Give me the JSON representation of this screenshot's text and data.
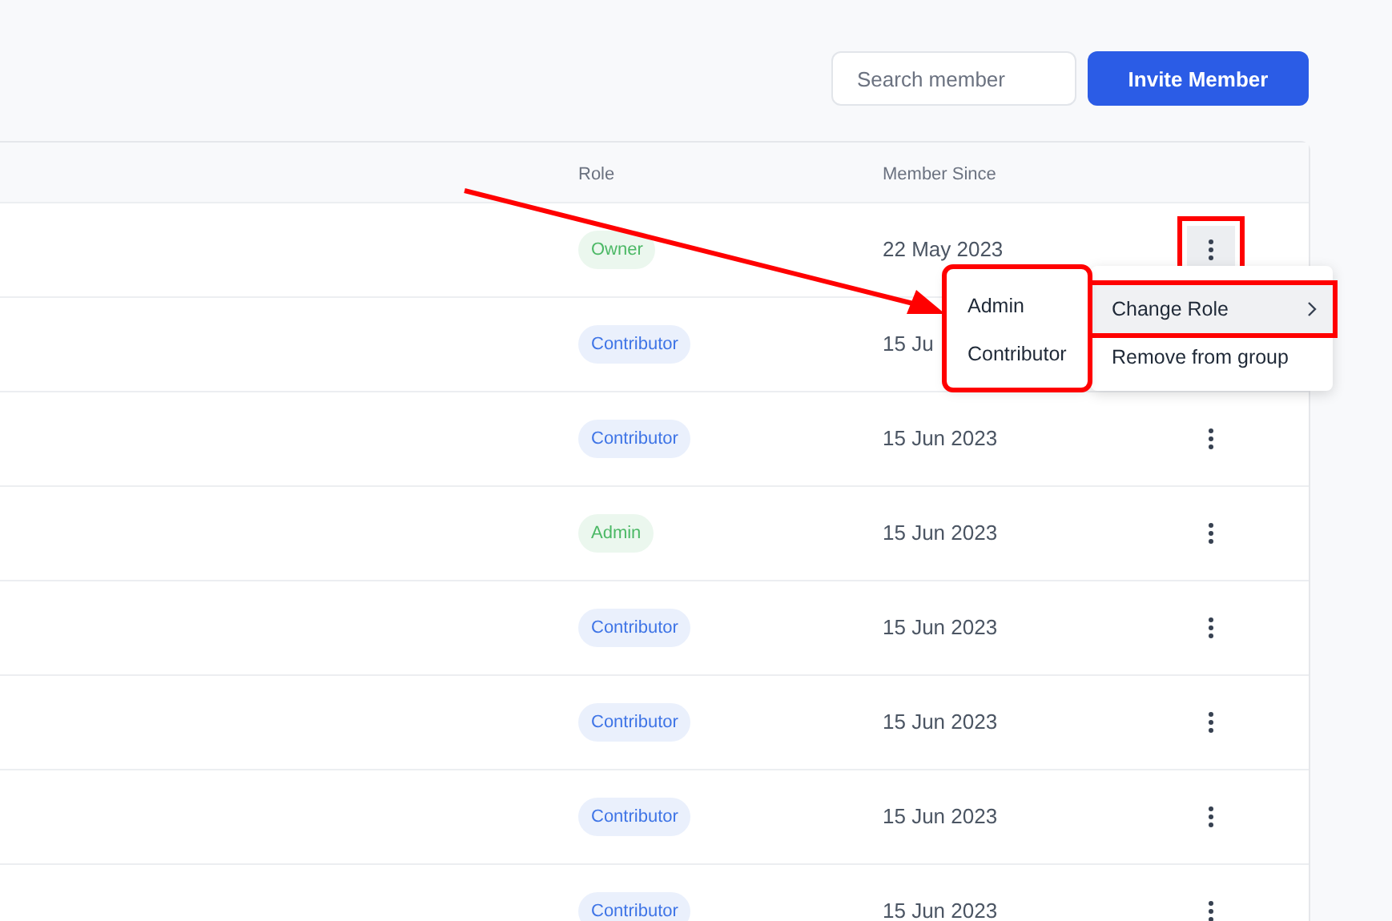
{
  "search": {
    "placeholder": "Search member"
  },
  "invite_button": "Invite Member",
  "table": {
    "columns": [
      "Role",
      "Member Since"
    ],
    "rows": [
      {
        "role": "Owner",
        "color": "#4bb865",
        "since": "22 May 2023",
        "menu_open": true
      },
      {
        "role": "Contributor",
        "color": "#3e74e6",
        "since": "15 Ju"
      },
      {
        "role": "Contributor",
        "color": "#3e74e6",
        "since": "15 Jun 2023",
        "menu_open": false
      },
      {
        "role": "Admin",
        "color": "#4bb865",
        "since": "15 Jun 2023",
        "menu_open": false
      },
      {
        "role": "Contributor",
        "color": "#3e74e6",
        "since": "15 Jun 2023",
        "menu_open": false
      },
      {
        "role": "Contributor",
        "color": "#3e74e6",
        "since": "15 Jun 2023",
        "menu_open": false
      },
      {
        "role": "Contributor",
        "color": "#3e74e6",
        "since": "15 Jun 2023",
        "menu_open": false
      },
      {
        "role": "Contributor",
        "color": "#3e74e6",
        "since": "15 Jun 2023",
        "menu_open": false
      }
    ]
  },
  "row_menu": {
    "items": [
      {
        "label": "Change Role",
        "hovered": true,
        "has_submenu": true
      },
      {
        "label": "Remove from group",
        "hovered": false,
        "has_submenu": false
      }
    ]
  },
  "role_submenu": {
    "items": [
      "Admin",
      "Contributor"
    ]
  },
  "annotation_arrow": true
}
